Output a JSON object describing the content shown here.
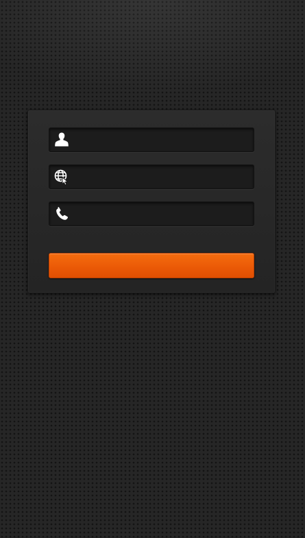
{
  "form": {
    "name_field": {
      "icon": "user-icon",
      "value": "",
      "placeholder": ""
    },
    "website_field": {
      "icon": "globe-cursor-icon",
      "value": "",
      "placeholder": ""
    },
    "phone_field": {
      "icon": "phone-icon",
      "value": "",
      "placeholder": ""
    },
    "submit_label": ""
  },
  "colors": {
    "background": "#262626",
    "panel": "#282828",
    "field": "#1c1c1c",
    "accent": "#f0620a",
    "icon": "#ffffff"
  }
}
